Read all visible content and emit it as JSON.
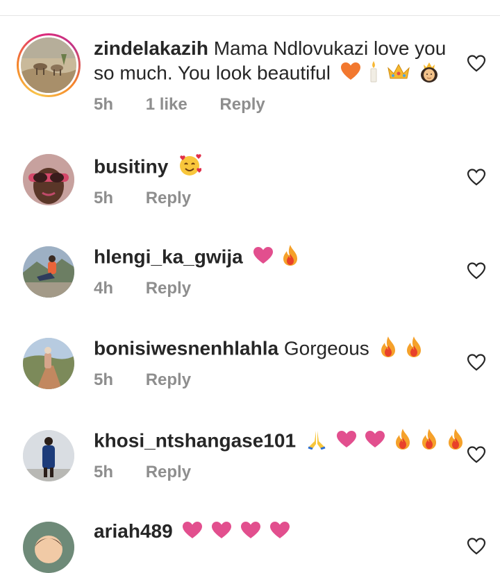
{
  "colors": {
    "text": "#262626",
    "meta": "#8e8e8e",
    "pink_heart": "#e24f8e",
    "orange_heart": "#f2782f",
    "flame_outer": "#f5a12a",
    "flame_inner": "#e8412a"
  },
  "comments": [
    {
      "username": "zindelakazih",
      "text": "Mama Ndlovukazi love you so much. You look beautiful",
      "text_line1": "Mama Ndlovukazi love you",
      "text_line2": "so much. You look beautiful",
      "emojis": [
        "orange-heart",
        "candle",
        "crown",
        "queen-face"
      ],
      "time": "5h",
      "likes": "1 like",
      "reply_label": "Reply",
      "has_story": true
    },
    {
      "username": "busitiny",
      "text": "",
      "emojis": [
        "smiling-face-with-hearts"
      ],
      "time": "5h",
      "reply_label": "Reply"
    },
    {
      "username": "hlengi_ka_gwija",
      "text": "",
      "emojis": [
        "pink-heart",
        "fire"
      ],
      "time": "4h",
      "reply_label": "Reply"
    },
    {
      "username": "bonisiwesnenhlahla",
      "text": "Gorgeous",
      "emojis": [
        "fire",
        "fire"
      ],
      "time": "5h",
      "reply_label": "Reply"
    },
    {
      "username": "khosi_ntshangase101",
      "text": "",
      "emojis": [
        "folded-hands",
        "pink-heart",
        "pink-heart",
        "fire",
        "fire",
        "fire"
      ],
      "time": "5h",
      "reply_label": "Reply"
    },
    {
      "username": "ariah489",
      "text": "",
      "emojis": [
        "pink-heart",
        "pink-heart",
        "pink-heart",
        "pink-heart"
      ]
    }
  ]
}
